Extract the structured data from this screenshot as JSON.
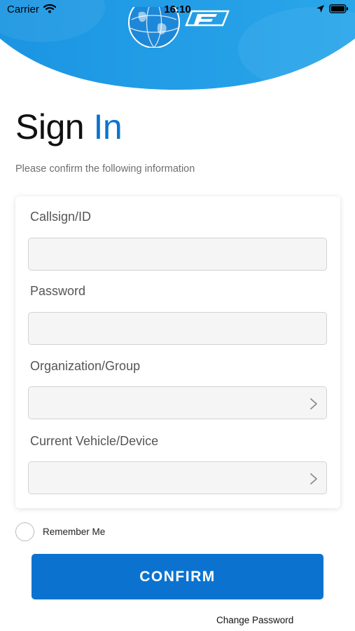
{
  "status_bar": {
    "carrier": "Carrier",
    "time": "16:10"
  },
  "header": {
    "brand_color": "#1f9be6",
    "logo_icon": "globe-logo-icon"
  },
  "signin": {
    "title_primary": "Sign",
    "title_accent": "In",
    "accent_color": "#0b73cf",
    "subtitle": "Please confirm the following information"
  },
  "form": {
    "callsign_label": "Callsign/ID",
    "callsign_value": "",
    "password_label": "Password",
    "password_value": "",
    "organization_label": "Organization/Group",
    "organization_value": "",
    "vehicle_label": "Current Vehicle/Device",
    "vehicle_value": ""
  },
  "remember_me": {
    "label": "Remember Me",
    "checked": false
  },
  "actions": {
    "confirm_label": "CONFIRM",
    "change_password_label": "Change Password"
  }
}
